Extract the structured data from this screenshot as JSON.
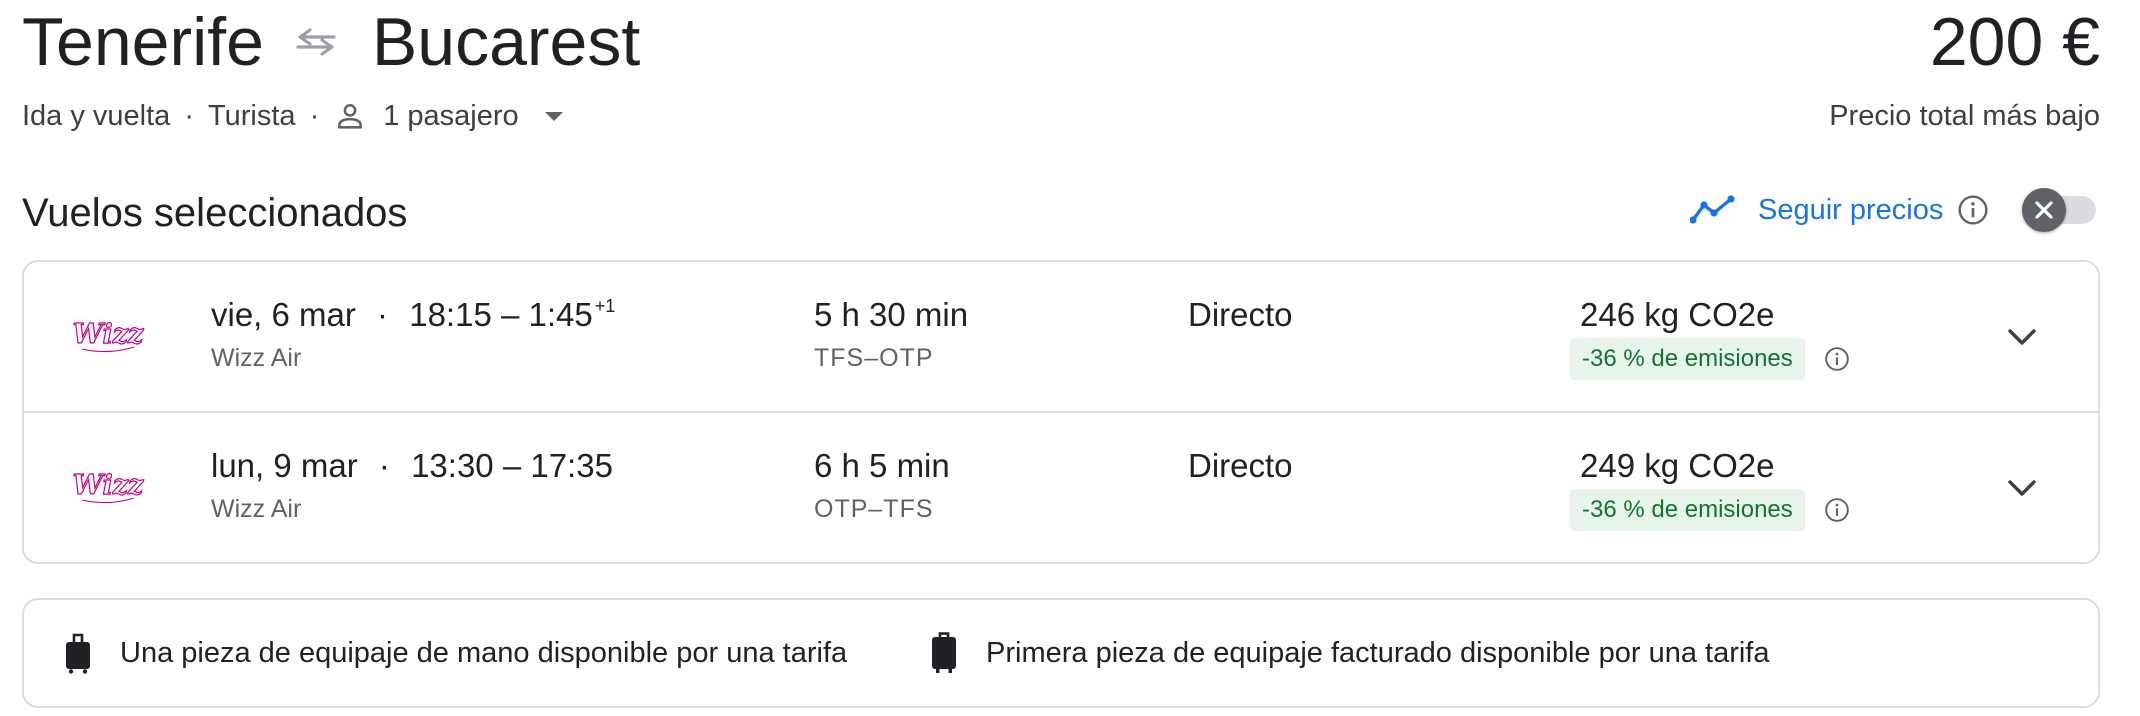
{
  "header": {
    "origin": "Tenerife",
    "destination": "Bucarest",
    "price": "200 €",
    "price_label": "Precio total más bajo",
    "trip_type": "Ida y vuelta",
    "cabin": "Turista",
    "passengers": "1 pasajero",
    "separator": "·"
  },
  "section": {
    "title": "Vuelos seleccionados",
    "track_prices_label": "Seguir precios",
    "toggle_state": "off"
  },
  "flights": [
    {
      "airline_logo": "Wizz",
      "date": "vie, 6 mar",
      "dot": "·",
      "times": "18:15 – 1:45",
      "day_offset": "+1",
      "airline": "Wizz Air",
      "duration": "5 h 30 min",
      "route": "TFS–OTP",
      "stops": "Directo",
      "co2": "246 kg CO2e",
      "emissions": "-36 % de emisiones"
    },
    {
      "airline_logo": "Wizz",
      "date": "lun, 9 mar",
      "dot": "·",
      "times": "13:30 – 17:35",
      "day_offset": "",
      "airline": "Wizz Air",
      "duration": "6 h 5 min",
      "route": "OTP–TFS",
      "stops": "Directo",
      "co2": "249 kg CO2e",
      "emissions": "-36 % de emisiones"
    }
  ],
  "baggage": {
    "carry_on": "Una pieza de equipaje de mano disponible por una tarifa",
    "checked": "Primera pieza de equipaje facturado disponible por una tarifa"
  },
  "colors": {
    "accent_blue": "#1a73e8",
    "emission_green": "#137333",
    "emission_bg": "#e6f4ea",
    "wizz_magenta": "#c6007e",
    "border": "#dadce0"
  },
  "icons": {
    "swap": "swap-arrows-icon",
    "person": "person-icon",
    "dropdown": "caret-down-icon",
    "trend": "trending-line-icon",
    "info": "info-icon",
    "close": "close-icon",
    "expand": "chevron-down-icon",
    "carry_on": "carry-on-bag-icon",
    "checked_bag": "checked-bag-icon"
  }
}
